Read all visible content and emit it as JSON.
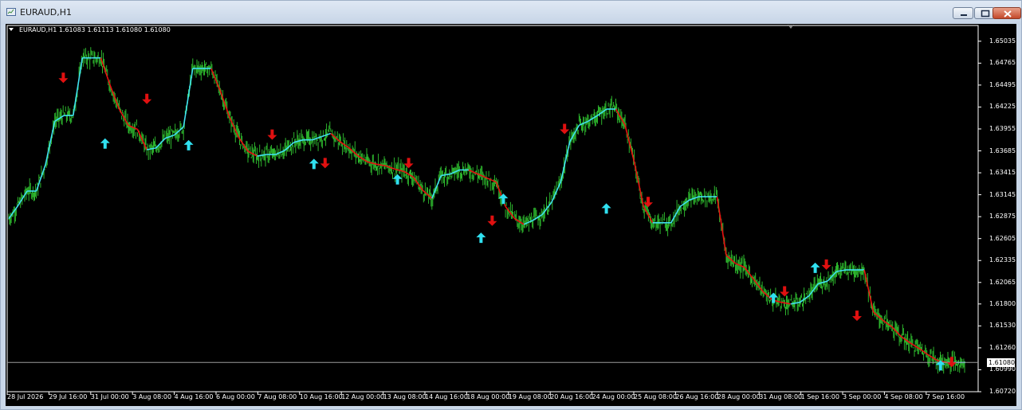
{
  "window": {
    "title": "EURAUD,H1"
  },
  "chart": {
    "header": "EURAUD,H1  1.61083 1.61113 1.61080 1.61080",
    "current_price_label": "1.61080",
    "colors": {
      "background": "#000000",
      "candles": "#2db52d",
      "trend_up": "#40e0f0",
      "trend_down": "#e81010",
      "arrow_up": "#30e0f0",
      "arrow_down": "#e01010",
      "axis_text": "#ffffff",
      "price_line": "#9a9a9a"
    }
  },
  "chart_data": {
    "type": "line",
    "symbol": "EURAUD",
    "timeframe": "H1",
    "ylim": [
      1.6072,
      1.6517
    ],
    "y_ticks": [
      "1.65035",
      "1.64765",
      "1.64495",
      "1.64225",
      "1.63955",
      "1.63685",
      "1.63415",
      "1.63145",
      "1.62875",
      "1.62605",
      "1.62335",
      "1.62065",
      "1.61800",
      "1.61530",
      "1.61260",
      "1.60990",
      "1.60720"
    ],
    "x_ticks": [
      "28 Jul 2026",
      "29 Jul 16:00",
      "31 Jul 00:00",
      "3 Aug 08:00",
      "4 Aug 16:00",
      "6 Aug 00:00",
      "7 Aug 08:00",
      "10 Aug 16:00",
      "12 Aug 00:00",
      "13 Aug 08:00",
      "14 Aug 16:00",
      "18 Aug 00:00",
      "19 Aug 08:00",
      "20 Aug 16:00",
      "24 Aug 00:00",
      "25 Aug 08:00",
      "26 Aug 16:00",
      "28 Aug 00:00",
      "31 Aug 08:00",
      "1 Sep 16:00",
      "3 Sep 00:00",
      "4 Sep 08:00",
      "7 Sep 16:00"
    ],
    "price_series": [
      1.6285,
      1.6301,
      1.6319,
      1.6319,
      1.6352,
      1.6405,
      1.6412,
      1.6412,
      1.6483,
      1.6483,
      1.6483,
      1.645,
      1.642,
      1.64,
      1.6395,
      1.637,
      1.6372,
      1.6384,
      1.6388,
      1.6398,
      1.647,
      1.647,
      1.647,
      1.6442,
      1.641,
      1.6385,
      1.6368,
      1.6362,
      1.6364,
      1.6364,
      1.6369,
      1.6379,
      1.6382,
      1.6382,
      1.6386,
      1.639,
      1.638,
      1.6372,
      1.6362,
      1.6355,
      1.6352,
      1.635,
      1.6346,
      1.6343,
      1.6336,
      1.632,
      1.631,
      1.6338,
      1.634,
      1.6345,
      1.6345,
      1.634,
      1.6335,
      1.633,
      1.63,
      1.6285,
      1.6278,
      1.6283,
      1.629,
      1.6305,
      1.633,
      1.638,
      1.64,
      1.6405,
      1.6412,
      1.642,
      1.642,
      1.64,
      1.6355,
      1.63,
      1.628,
      1.628,
      1.628,
      1.63,
      1.6308,
      1.6312,
      1.6312,
      1.6312,
      1.624,
      1.623,
      1.6225,
      1.621,
      1.6195,
      1.6185,
      1.6182,
      1.618,
      1.6182,
      1.619,
      1.6205,
      1.6208,
      1.622,
      1.6222,
      1.6222,
      1.6222,
      1.617,
      1.616,
      1.6152,
      1.614,
      1.6132,
      1.6125,
      1.6117,
      1.611,
      1.6108,
      1.6108,
      1.6108
    ],
    "trend_line_colors": "up=cyan, down=red",
    "signals": [
      {
        "type": "sell",
        "x_tick": "29 Jul 16:00",
        "price": 1.6458
      },
      {
        "type": "buy",
        "x_tick": "31 Jul 00:00",
        "price": 1.6378
      },
      {
        "type": "sell",
        "x_tick": "3 Aug 08:00",
        "price": 1.6432
      },
      {
        "type": "buy",
        "x_tick": "4 Aug 16:00",
        "price": 1.6376
      },
      {
        "type": "sell",
        "x_tick": "7 Aug 08:00",
        "price": 1.6388
      },
      {
        "type": "buy",
        "x_tick": "10 Aug 16:00",
        "price": 1.6353
      },
      {
        "type": "sell",
        "x_tick": "10 Aug 16:00",
        "price": 1.6353
      },
      {
        "type": "buy",
        "x_tick": "13 Aug 08:00",
        "price": 1.6334
      },
      {
        "type": "sell",
        "x_tick": "13 Aug 08:00",
        "price": 1.6353
      },
      {
        "type": "buy",
        "x_tick": "18 Aug 00:00",
        "price": 1.6262
      },
      {
        "type": "sell",
        "x_tick": "18 Aug 00:00",
        "price": 1.6282
      },
      {
        "type": "buy",
        "x_tick": "18 Aug 00:00",
        "price": 1.631
      },
      {
        "type": "sell",
        "x_tick": "20 Aug 16:00",
        "price": 1.6395
      },
      {
        "type": "buy",
        "x_tick": "24 Aug 00:00",
        "price": 1.6298
      },
      {
        "type": "sell",
        "x_tick": "25 Aug 08:00",
        "price": 1.6305
      },
      {
        "type": "buy",
        "x_tick": "31 Aug 08:00",
        "price": 1.6188
      },
      {
        "type": "sell",
        "x_tick": "31 Aug 08:00",
        "price": 1.6195
      },
      {
        "type": "buy",
        "x_tick": "1 Sep 16:00",
        "price": 1.6225
      },
      {
        "type": "sell",
        "x_tick": "1 Sep 16:00",
        "price": 1.6228
      },
      {
        "type": "sell",
        "x_tick": "3 Sep 00:00",
        "price": 1.6165
      },
      {
        "type": "buy",
        "x_tick": "7 Sep 16:00",
        "price": 1.6105
      },
      {
        "type": "sell",
        "x_tick": "7 Sep 16:00",
        "price": 1.6108
      }
    ],
    "current_price": 1.6108,
    "grid": false
  }
}
